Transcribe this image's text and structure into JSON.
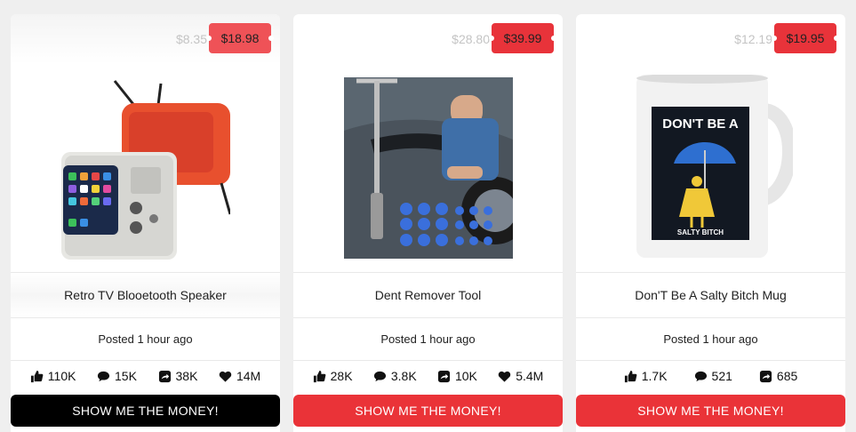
{
  "products": [
    {
      "title": "Retro TV Blooetooth Speaker",
      "original_price": "$8.35",
      "sale_price": "$18.98",
      "posted": "Posted 1 hour ago",
      "likes": "110K",
      "comments": "15K",
      "shares": "38K",
      "hearts": "14M",
      "button_label": "SHOW ME THE MONEY!"
    },
    {
      "title": "Dent Remover Tool",
      "original_price": "$28.80",
      "sale_price": "$39.99",
      "posted": "Posted 1 hour ago",
      "likes": "28K",
      "comments": "3.8K",
      "shares": "10K",
      "hearts": "5.4M",
      "button_label": "SHOW ME THE MONEY!"
    },
    {
      "title": "Don'T Be A Salty Bitch Mug",
      "original_price": "$12.19",
      "sale_price": "$19.95",
      "posted": "Posted 1 hour ago",
      "likes": "1.7K",
      "comments": "521",
      "shares": "685",
      "button_label": "SHOW ME THE MONEY!",
      "mug_text_top": "DON'T BE A",
      "mug_text_bottom": "SALTY BITCH"
    }
  ],
  "colors": {
    "accent_red": "#ea3338",
    "button_dark": "#000000",
    "background": "#efefef"
  },
  "icons": [
    "thumbs-up-icon",
    "comment-icon",
    "share-icon",
    "heart-icon"
  ]
}
